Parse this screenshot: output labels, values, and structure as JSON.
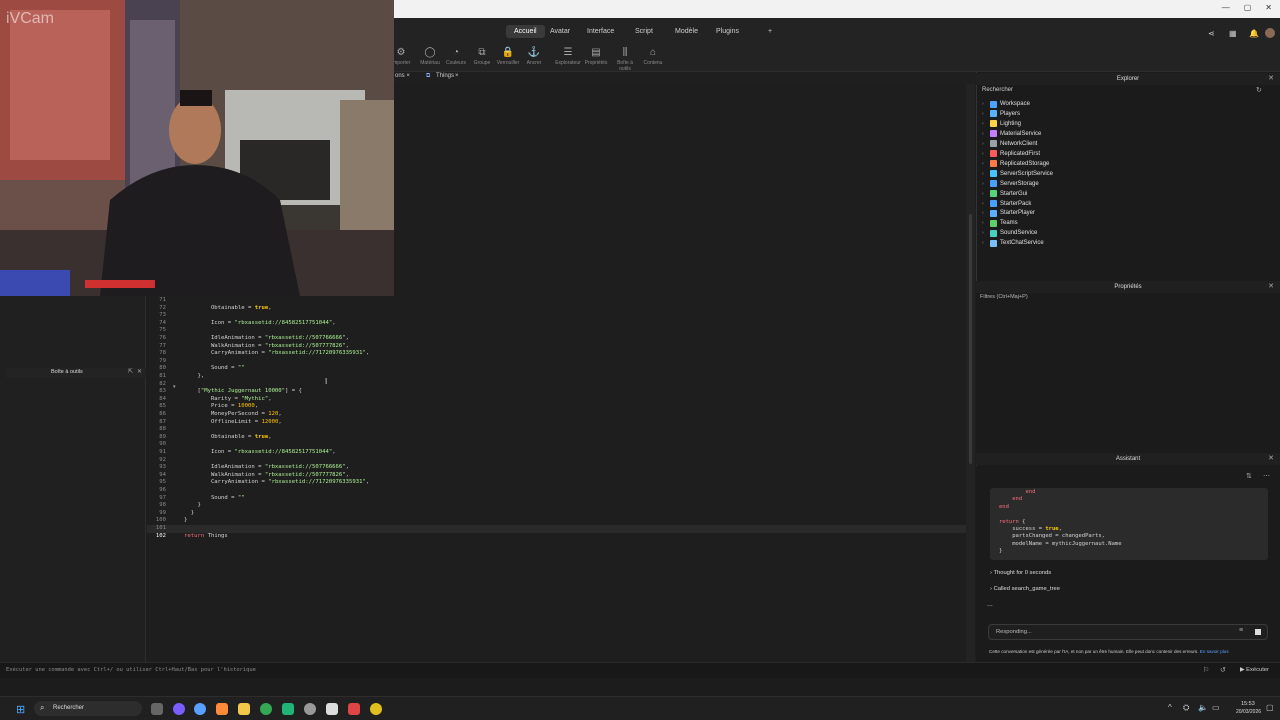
{
  "webcam": {
    "label": "iVCam"
  },
  "menu": {
    "tabs": [
      "Accueil",
      "Avatar",
      "Interface",
      "Script",
      "Modèle",
      "Plugins",
      "+"
    ],
    "active": "Accueil"
  },
  "ribbon": {
    "items": [
      "Importer",
      "Matériau",
      "Couleurs",
      "Groupe",
      "Verrouiller",
      "Ancrer",
      "Explorateur",
      "Propriétés",
      "Boîte à outils",
      "Contenu"
    ]
  },
  "doctabs": {
    "tab1_close": "ons ×",
    "tab2": "Things",
    "tab2_close": "×"
  },
  "editor": {
    "lines": [
      {
        "n": "71",
        "t": ""
      },
      {
        "n": "72",
        "t": "Obtainable = true,"
      },
      {
        "n": "73",
        "t": ""
      },
      {
        "n": "74",
        "t": "Icon = \"rbxassetid://84582517751044\","
      },
      {
        "n": "75",
        "t": ""
      },
      {
        "n": "76",
        "t": "IdleAnimation = \"rbxassetid://507766666\","
      },
      {
        "n": "77",
        "t": "WalkAnimation = \"rbxassetid://507777826\","
      },
      {
        "n": "78",
        "t": "CarryAnimation = \"rbxassetid://71720976335931\","
      },
      {
        "n": "79",
        "t": ""
      },
      {
        "n": "80",
        "t": "Sound = \"\""
      },
      {
        "n": "81",
        "t": "},"
      },
      {
        "n": "82",
        "t": ""
      },
      {
        "n": "83",
        "t": "[\"Mythic Juggernaut 10000\"] = {"
      },
      {
        "n": "84",
        "t": "Rarity = \"Mythic\","
      },
      {
        "n": "85",
        "t": "Price = 10000,"
      },
      {
        "n": "86",
        "t": "MoneyPerSecond = 120,"
      },
      {
        "n": "87",
        "t": "OfflineLimit = 12000,"
      },
      {
        "n": "88",
        "t": ""
      },
      {
        "n": "89",
        "t": "Obtainable = true,"
      },
      {
        "n": "90",
        "t": ""
      },
      {
        "n": "91",
        "t": "Icon = \"rbxassetid://84582517751044\","
      },
      {
        "n": "92",
        "t": ""
      },
      {
        "n": "93",
        "t": "IdleAnimation = \"rbxassetid://507766666\","
      },
      {
        "n": "94",
        "t": "WalkAnimation = \"rbxassetid://507777826\","
      },
      {
        "n": "95",
        "t": "CarryAnimation = \"rbxassetid://71720976335931\","
      },
      {
        "n": "96",
        "t": ""
      },
      {
        "n": "97",
        "t": "Sound = \"\""
      },
      {
        "n": "98",
        "t": "}"
      },
      {
        "n": "99",
        "t": "}"
      },
      {
        "n": "100",
        "t": "}"
      },
      {
        "n": "101",
        "t": ""
      },
      {
        "n": "102",
        "t": "return Things"
      }
    ]
  },
  "toolbox": {
    "title": "Boîte à outils"
  },
  "explorer": {
    "title": "Explorer",
    "search_placeholder": "Rechercher",
    "items": [
      {
        "label": "Workspace",
        "color": "#4aa3ff"
      },
      {
        "label": "Players",
        "color": "#5ab0ff"
      },
      {
        "label": "Lighting",
        "color": "#ffd24a"
      },
      {
        "label": "MaterialService",
        "color": "#c77dff"
      },
      {
        "label": "NetworkClient",
        "color": "#9aa0a6"
      },
      {
        "label": "ReplicatedFirst",
        "color": "#ff5a5a"
      },
      {
        "label": "ReplicatedStorage",
        "color": "#ff7a4a"
      },
      {
        "label": "ServerScriptService",
        "color": "#4ac2ff"
      },
      {
        "label": "ServerStorage",
        "color": "#4a9eff"
      },
      {
        "label": "StarterGui",
        "color": "#57d37a"
      },
      {
        "label": "StarterPack",
        "color": "#4aa0ff"
      },
      {
        "label": "StarterPlayer",
        "color": "#5ab0ff"
      },
      {
        "label": "Teams",
        "color": "#5fd06a"
      },
      {
        "label": "SoundService",
        "color": "#4ad0c0"
      },
      {
        "label": "TextChatService",
        "color": "#7ac0ff"
      }
    ]
  },
  "properties": {
    "title": "Propriétés",
    "filter": "Filtres (Ctrl+Maj+P)"
  },
  "assistant": {
    "title": "Assistant",
    "code_lines": [
      "        end",
      "    end",
      "end",
      "",
      "return {",
      "    success = true,",
      "    partsChanged = changedParts,",
      "    modelName = mythicJuggernaut.Name",
      "}"
    ],
    "thought": "Thought for 0 seconds",
    "called": "Called search_game_tree",
    "dots": "...",
    "responding": "Responding...",
    "disclaimer": "Cette conversation est générée par l'IA, et non par un être humain. Elle peut donc contenir des erreurs.",
    "learn_more": "En savoir plus"
  },
  "cmdbar": {
    "placeholder": "Exécuter une commande avec Ctrl+/ ou utiliser Ctrl+Haut/Bas pour l'historique",
    "run": "Exécuter"
  },
  "taskbar": {
    "search": "Rechercher",
    "time": "15:53",
    "date": "20/03/2026"
  }
}
